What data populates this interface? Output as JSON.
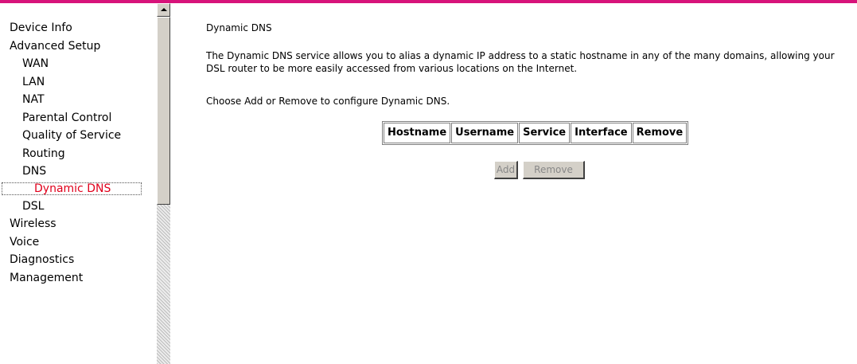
{
  "sidebar": {
    "items": [
      {
        "label": "Device Info"
      },
      {
        "label": "Advanced Setup"
      },
      {
        "label": "WAN"
      },
      {
        "label": "LAN"
      },
      {
        "label": "NAT"
      },
      {
        "label": "Parental Control"
      },
      {
        "label": "Quality of Service"
      },
      {
        "label": "Routing"
      },
      {
        "label": "DNS"
      },
      {
        "label": "Dynamic DNS"
      },
      {
        "label": "DSL"
      },
      {
        "label": "Wireless"
      },
      {
        "label": "Voice"
      },
      {
        "label": "Diagnostics"
      },
      {
        "label": "Management"
      }
    ]
  },
  "main": {
    "title": "Dynamic DNS",
    "description": "The Dynamic DNS service allows you to alias a dynamic IP address to a static hostname in any of the many domains, allowing your DSL router to be more easily accessed from various locations on the Internet.",
    "instruction": "Choose Add or Remove to configure Dynamic DNS.",
    "table": {
      "headers": [
        "Hostname",
        "Username",
        "Service",
        "Interface",
        "Remove"
      ]
    },
    "buttons": {
      "add": "Add",
      "remove": "Remove"
    }
  },
  "colors": {
    "accent_bar": "#d7137a",
    "active_menu": "#e0001b"
  }
}
